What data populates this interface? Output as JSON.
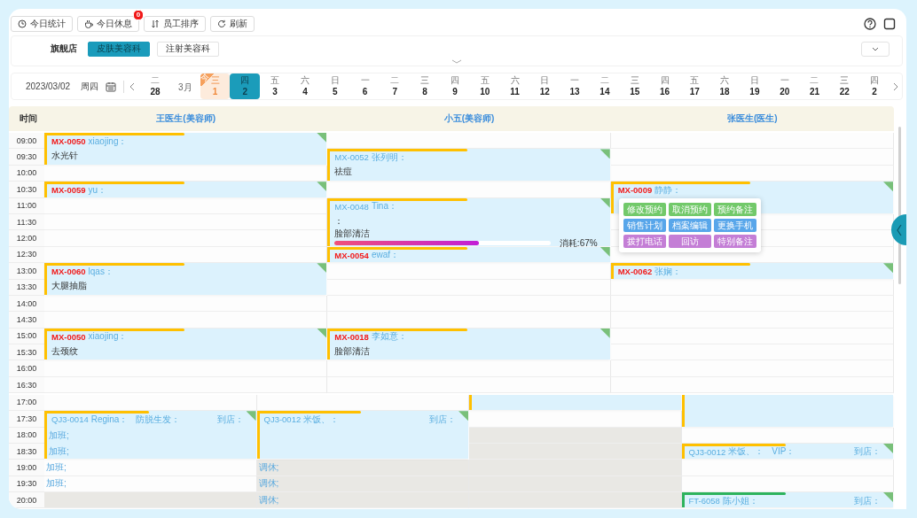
{
  "toolbar": {
    "buttons": [
      {
        "label": "今日统计"
      },
      {
        "label": "今日休息",
        "badge": "0"
      },
      {
        "label": "员工排序"
      },
      {
        "label": "刷新"
      }
    ]
  },
  "store": {
    "label": "旗舰店",
    "tabs": [
      {
        "label": "皮肤美容科",
        "selected": true
      },
      {
        "label": "注射美容科",
        "selected": false
      }
    ]
  },
  "date_bar": {
    "date": "2023/03/02",
    "weekday": "周四",
    "days": [
      {
        "kind": "day",
        "weekday": "二",
        "day": "28",
        "selected": false,
        "today": false
      },
      {
        "kind": "month",
        "label": "3月"
      },
      {
        "kind": "day",
        "weekday": "三",
        "day": "1",
        "selected": false,
        "today": true,
        "badge": "今"
      },
      {
        "kind": "day",
        "weekday": "四",
        "day": "2",
        "selected": true,
        "today": false
      },
      {
        "kind": "day",
        "weekday": "五",
        "day": "3",
        "selected": false,
        "today": false
      },
      {
        "kind": "day",
        "weekday": "六",
        "day": "4",
        "selected": false,
        "today": false
      },
      {
        "kind": "day",
        "weekday": "日",
        "day": "5",
        "selected": false,
        "today": false
      },
      {
        "kind": "day",
        "weekday": "一",
        "day": "6",
        "selected": false,
        "today": false
      },
      {
        "kind": "day",
        "weekday": "二",
        "day": "7",
        "selected": false,
        "today": false
      },
      {
        "kind": "day",
        "weekday": "三",
        "day": "8",
        "selected": false,
        "today": false
      },
      {
        "kind": "day",
        "weekday": "四",
        "day": "9",
        "selected": false,
        "today": false
      },
      {
        "kind": "day",
        "weekday": "五",
        "day": "10",
        "selected": false,
        "today": false
      },
      {
        "kind": "day",
        "weekday": "六",
        "day": "11",
        "selected": false,
        "today": false
      },
      {
        "kind": "day",
        "weekday": "日",
        "day": "12",
        "selected": false,
        "today": false
      },
      {
        "kind": "day",
        "weekday": "一",
        "day": "13",
        "selected": false,
        "today": false
      },
      {
        "kind": "day",
        "weekday": "二",
        "day": "14",
        "selected": false,
        "today": false
      },
      {
        "kind": "day",
        "weekday": "三",
        "day": "15",
        "selected": false,
        "today": false
      },
      {
        "kind": "day",
        "weekday": "四",
        "day": "16",
        "selected": false,
        "today": false
      },
      {
        "kind": "day",
        "weekday": "五",
        "day": "17",
        "selected": false,
        "today": false
      },
      {
        "kind": "day",
        "weekday": "六",
        "day": "18",
        "selected": false,
        "today": false
      },
      {
        "kind": "day",
        "weekday": "日",
        "day": "19",
        "selected": false,
        "today": false
      },
      {
        "kind": "day",
        "weekday": "一",
        "day": "20",
        "selected": false,
        "today": false
      },
      {
        "kind": "day",
        "weekday": "二",
        "day": "21",
        "selected": false,
        "today": false
      },
      {
        "kind": "day",
        "weekday": "三",
        "day": "22",
        "selected": false,
        "today": false
      },
      {
        "kind": "day",
        "weekday": "四",
        "day": "2",
        "selected": false,
        "today": false
      }
    ]
  },
  "schedule": {
    "time_label": "时间",
    "times": [
      "09:00",
      "09:30",
      "10:00",
      "10:30",
      "11:00",
      "11:30",
      "12:00",
      "12:30",
      "13:00",
      "13:30",
      "14:00",
      "14:30",
      "15:00",
      "15:30",
      "16:00",
      "16:30"
    ],
    "columns": [
      {
        "name": "王医生(美容师)",
        "slots": [
          {
            "kind": "booking",
            "color": "#ffc000",
            "flagged": true,
            "code": "MX-0050",
            "name": "xiaojing：",
            "lines": [
              "水光针"
            ]
          },
          {
            "kind": "continued"
          },
          {
            "kind": "open"
          },
          {
            "kind": "booking",
            "color": "#ffc000",
            "flagged": true,
            "code": "MX-0059",
            "name": "yu："
          },
          {
            "kind": "open"
          },
          {
            "kind": "open"
          },
          {
            "kind": "open"
          },
          {
            "kind": "open"
          },
          {
            "kind": "booking",
            "color": "#ffc000",
            "flagged": true,
            "code": "MX-0060",
            "name": "lqas：",
            "lines": [
              "大腿抽脂"
            ]
          },
          {
            "kind": "continued"
          },
          {
            "kind": "open"
          },
          {
            "kind": "open"
          },
          {
            "kind": "booking",
            "color": "#ffc000",
            "flagged": true,
            "code": "MX-0050",
            "name": "xiaojing：",
            "lines": [
              "去颈纹"
            ]
          },
          {
            "kind": "continued"
          },
          {
            "kind": "open"
          },
          {
            "kind": "open"
          }
        ]
      },
      {
        "name": "小五(美容师)",
        "slots": [
          {
            "kind": "open"
          },
          {
            "kind": "booking",
            "color": "#ffc000",
            "flagged": false,
            "code": "MX-0052",
            "name": "张列明：",
            "lines": [
              "祛痘"
            ]
          },
          {
            "kind": "continued"
          },
          {
            "kind": "open"
          },
          {
            "kind": "booking",
            "color": "#ffc000",
            "flagged": false,
            "code": "MX-0048",
            "name": "Tina：",
            "lines": [
              "：",
              "脸部清洁"
            ],
            "progress": {
              "level": 0.67,
              "label": "消耗:67%"
            }
          },
          {
            "kind": "continued"
          },
          {
            "kind": "continued"
          },
          {
            "kind": "booking",
            "color": "#ffc000",
            "flagged": true,
            "code": "MX-0054",
            "name": "ewaf："
          },
          {
            "kind": "open"
          },
          {
            "kind": "open"
          },
          {
            "kind": "open"
          },
          {
            "kind": "open"
          },
          {
            "kind": "booking",
            "color": "#ffc000",
            "flagged": true,
            "code": "MX-0018",
            "name": "李如意：",
            "lines": [
              "脸部清洁"
            ]
          },
          {
            "kind": "continued"
          },
          {
            "kind": "open"
          },
          {
            "kind": "open"
          }
        ]
      },
      {
        "name": "张医生(医生)",
        "slots": [
          {
            "kind": "open"
          },
          {
            "kind": "open"
          },
          {
            "kind": "open"
          },
          {
            "kind": "booking",
            "color": "#ffc000",
            "flagged": true,
            "code": "MX-0009",
            "name": "静静：",
            "menu": [
              {
                "label": "修改预约",
                "color": "#72c96a"
              },
              {
                "label": "取消预约",
                "color": "#72c96a"
              },
              {
                "label": "预约备注",
                "color": "#72c96a"
              },
              {
                "label": "销售计划",
                "color": "#58a6ea"
              },
              {
                "label": "档案编辑",
                "color": "#58a6ea"
              },
              {
                "label": "更换手机",
                "color": "#58a6ea"
              },
              {
                "label": "拨打电话",
                "color": "#c47ed6"
              },
              {
                "label": "回访",
                "color": "#c47ed6"
              },
              {
                "label": "特别备注",
                "color": "#c47ed6"
              }
            ]
          },
          {
            "kind": "continued"
          },
          {
            "kind": "open"
          },
          {
            "kind": "open"
          },
          {
            "kind": "open"
          },
          {
            "kind": "booking",
            "color": "#ffc000",
            "flagged": true,
            "code": "MX-0062",
            "name": "张娴："
          },
          {
            "kind": "open"
          },
          {
            "kind": "open"
          },
          {
            "kind": "open"
          },
          {
            "kind": "open"
          },
          {
            "kind": "open"
          },
          {
            "kind": "open"
          },
          {
            "kind": "open"
          }
        ]
      }
    ]
  },
  "shifts": {
    "times": [
      "17:00",
      "17:30",
      "18:00",
      "18:30",
      "19:00",
      "19:30",
      "20:00"
    ],
    "columns": [
      {
        "slots": [
          {
            "kind": "open"
          },
          {
            "kind": "booking",
            "color": "#ffc000",
            "flagged": false,
            "code": "QJ3-0014",
            "name": "Regina：",
            "tag": "防脱生发：",
            "arrival": "到店："
          },
          {
            "kind": "continued",
            "note": "加班;"
          },
          {
            "kind": "continued",
            "note": "加班;"
          },
          {
            "kind": "open",
            "note": "加班;"
          },
          {
            "kind": "open",
            "note": "加班;"
          },
          {
            "kind": "off"
          }
        ]
      },
      {
        "slots": [
          {
            "kind": "open"
          },
          {
            "kind": "booking",
            "color": "#ffc000",
            "flagged": false,
            "code": "QJ3-0012",
            "name": "米饭、：",
            "arrival": "到店："
          },
          {
            "kind": "continued"
          },
          {
            "kind": "continued"
          },
          {
            "kind": "off",
            "note": "调休;"
          },
          {
            "kind": "off",
            "note": "调休;"
          },
          {
            "kind": "off",
            "note": "调休;"
          }
        ]
      },
      {
        "slots": [
          {
            "kind": "block",
            "color": "#ffc000"
          },
          {
            "kind": "open"
          },
          {
            "kind": "off"
          },
          {
            "kind": "off"
          },
          {
            "kind": "off"
          },
          {
            "kind": "off"
          },
          {
            "kind": "off"
          }
        ]
      },
      {
        "slots": [
          {
            "kind": "block",
            "color": "#ffc000"
          },
          {
            "kind": "continued"
          },
          {
            "kind": "open"
          },
          {
            "kind": "booking",
            "color": "#ffc000",
            "flagged": false,
            "code": "QJ3-0012",
            "name": "米饭、：",
            "tag": "VIP：",
            "arrival": "到店："
          },
          {
            "kind": "open"
          },
          {
            "kind": "open"
          },
          {
            "kind": "booking",
            "color": "#2db35d",
            "flagged": false,
            "code": "FT-6058",
            "name": "陈小姐：",
            "arrival": "到店："
          }
        ]
      }
    ]
  }
}
